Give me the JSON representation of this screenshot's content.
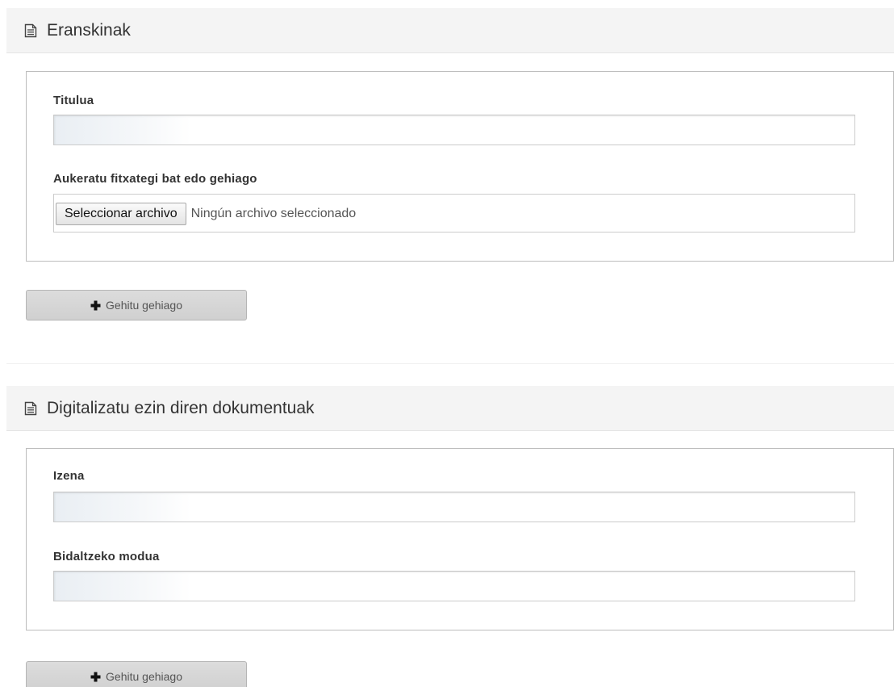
{
  "attachments_section": {
    "title": "Eranskinak",
    "icon": "document-icon",
    "fields": {
      "title_label": "Titulua",
      "title_value": "",
      "files_label": "Aukeratu fitxategi bat edo gehiago",
      "file_button_label": "Seleccionar archivo",
      "file_status": "Ningún archivo seleccionado"
    },
    "add_more_label": "Gehitu gehiago",
    "add_more_icon": "plus-icon"
  },
  "non_digital_section": {
    "title": "Digitalizatu ezin diren dokumentuak",
    "icon": "document-icon",
    "fields": {
      "name_label": "Izena",
      "name_value": "",
      "send_mode_label": "Bidaltzeko modua",
      "send_mode_value": ""
    },
    "add_more_label": "Gehitu gehiago",
    "add_more_icon": "plus-icon"
  },
  "colors": {
    "header_bg": "#f4f4f4",
    "border": "#bdbdbd",
    "button_bg": "#d6d6d6",
    "text": "#333333"
  }
}
